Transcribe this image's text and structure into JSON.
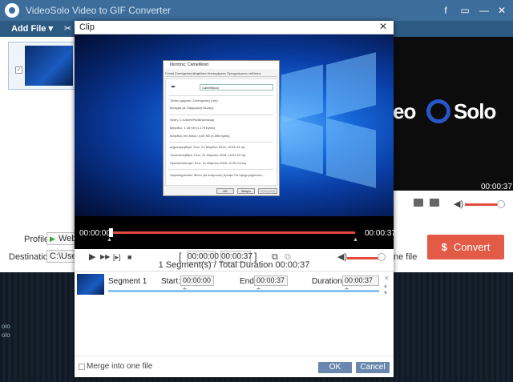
{
  "app": {
    "title": "VideoSolo Video to GIF Converter",
    "facebook_icon": "f",
    "minimize_icon": "—",
    "close_icon": "✕",
    "toolbar": {
      "add_file": "Add File ▾",
      "tool_icon": "✂"
    },
    "preview": {
      "brand_left": "eo",
      "brand_right": "Solo",
      "time": "00:00:37"
    },
    "bottom": {
      "profile_label": "Profile:",
      "profile_value": "WebM",
      "destination_label": "Destination:",
      "destination_value": "C:\\Users\\",
      "one_file": "ne file",
      "convert": "Convert",
      "convert_icon": "$"
    },
    "desktop_text": "oio\nolo"
  },
  "clip": {
    "title": "Clip",
    "close_icon": "✕",
    "video": {
      "time_start": "00:00:00",
      "time_end": "00:00:37",
      "win_dialog": {
        "title": "Ιδιότητες: CameMood",
        "tabs": "Γενικά   Συντόμευση   Ασφάλεια   Λεπτομέρειες   Προηγούμενες εκδόσεις",
        "name": "CameMood",
        "rows": [
          "Τύπος αρχείου:     Συντόμευση (.lnk)",
          "Άνοιγμα με:        Εφαρμογή                    Αλλαγή",
          "Θέση:              C:\\Users\\Public\\Desktop",
          "Μέγεθος:           1,16 KB (1.179 bytes)",
          "Μέγεθος στο δίσκο: 4,00 KB (4.096 bytes)",
          "Δημιουργήθηκε:     Κλιν, 21 Μαρτίου 2018, 10:51:24 πμ",
          "Τροποποιήθηκε:     Κλιν, 21 Μαρτίου 2018, 10:51:24 πμ",
          "Προσπελάστηκε:     Κλιν, 21 Μαρτίου 2018, 10:51:24 πμ",
          "Χαρακτηριστικά:    Μόνο για ανάγνωση   Κρυφό     Για προχωρημένους..."
        ],
        "ok": "OK",
        "cancel": "Άκυρο",
        "apply": "Εφαρμογή"
      }
    },
    "controls": {
      "play_icon": "▶",
      "forward_icon": "▶▶",
      "frame_icon": "[▸]",
      "stop_icon": "■",
      "bracket_left": "[",
      "start_time": "00:00:00",
      "end_time": "00:00:37",
      "bracket_right": "]",
      "cut_icon": "⧉",
      "vol_icon": "◀)"
    },
    "summary": "1 Segment(s) / Total Duration 00:00:37",
    "segment": {
      "name": "Segment 1",
      "start_label": "Start:",
      "start_value": "00:00:00 ÷",
      "end_label": "End:",
      "end_value": "00:00:37 ÷",
      "duration_label": "Duration:",
      "duration_value": "00:00:37 ÷",
      "side_icons": "✕\n▴\n▾"
    },
    "footer": {
      "merge_label": "Merge into one file",
      "ok": "OK",
      "cancel": "Cancel"
    }
  }
}
